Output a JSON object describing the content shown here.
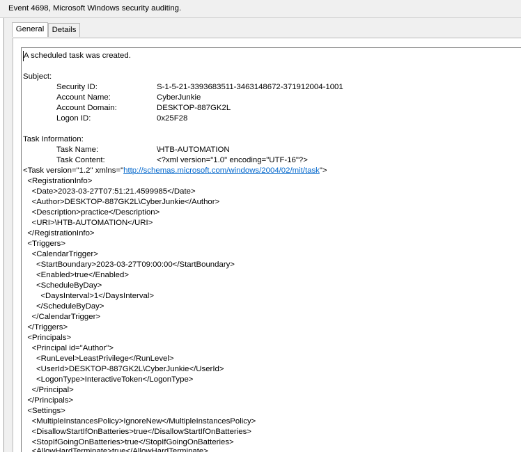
{
  "window": {
    "title": "Event 4698, Microsoft Windows security auditing."
  },
  "tabs": [
    {
      "label": "General",
      "active": true
    },
    {
      "label": "Details",
      "active": false
    }
  ],
  "event": {
    "description": "A scheduled task was created.",
    "subject_heading": "Subject:",
    "subject": {
      "security_id_label": "Security ID:",
      "security_id": "S-1-5-21-3393683511-3463148672-371912004-1001",
      "account_name_label": "Account Name:",
      "account_name": "CyberJunkie",
      "account_domain_label": "Account Domain:",
      "account_domain": "DESKTOP-887GK2L",
      "logon_id_label": "Logon ID:",
      "logon_id": "0x25F28"
    },
    "task_heading": "Task Information:",
    "task": {
      "name_label": "Task Name:",
      "name": "\\HTB-AUTOMATION",
      "content_label": "Task Content:",
      "xml_declaration": "<?xml version=\"1.0\" encoding=\"UTF-16\"?>"
    },
    "xml_task_open_prefix": "<Task version=\"1.2\" xmlns=\"",
    "xml_namespace_url": "http://schemas.microsoft.com/windows/2004/02/mit/task",
    "xml_task_open_suffix": "\">",
    "xml_lines": [
      "  <RegistrationInfo>",
      "    <Date>2023-03-27T07:51:21.4599985</Date>",
      "    <Author>DESKTOP-887GK2L\\CyberJunkie</Author>",
      "    <Description>practice</Description>",
      "    <URI>\\HTB-AUTOMATION</URI>",
      "  </RegistrationInfo>",
      "  <Triggers>",
      "    <CalendarTrigger>",
      "      <StartBoundary>2023-03-27T09:00:00</StartBoundary>",
      "      <Enabled>true</Enabled>",
      "      <ScheduleByDay>",
      "        <DaysInterval>1</DaysInterval>",
      "      </ScheduleByDay>",
      "    </CalendarTrigger>",
      "  </Triggers>",
      "  <Principals>",
      "    <Principal id=\"Author\">",
      "      <RunLevel>LeastPrivilege</RunLevel>",
      "      <UserId>DESKTOP-887GK2L\\CyberJunkie</UserId>",
      "      <LogonType>InteractiveToken</LogonType>",
      "    </Principal>",
      "  </Principals>",
      "  <Settings>",
      "    <MultipleInstancesPolicy>IgnoreNew</MultipleInstancesPolicy>",
      "    <DisallowStartIfOnBatteries>true</DisallowStartIfOnBatteries>",
      "    <StopIfGoingOnBatteries>true</StopIfGoingOnBatteries>",
      "    <AllowHardTerminate>true</AllowHardTerminate>"
    ]
  }
}
